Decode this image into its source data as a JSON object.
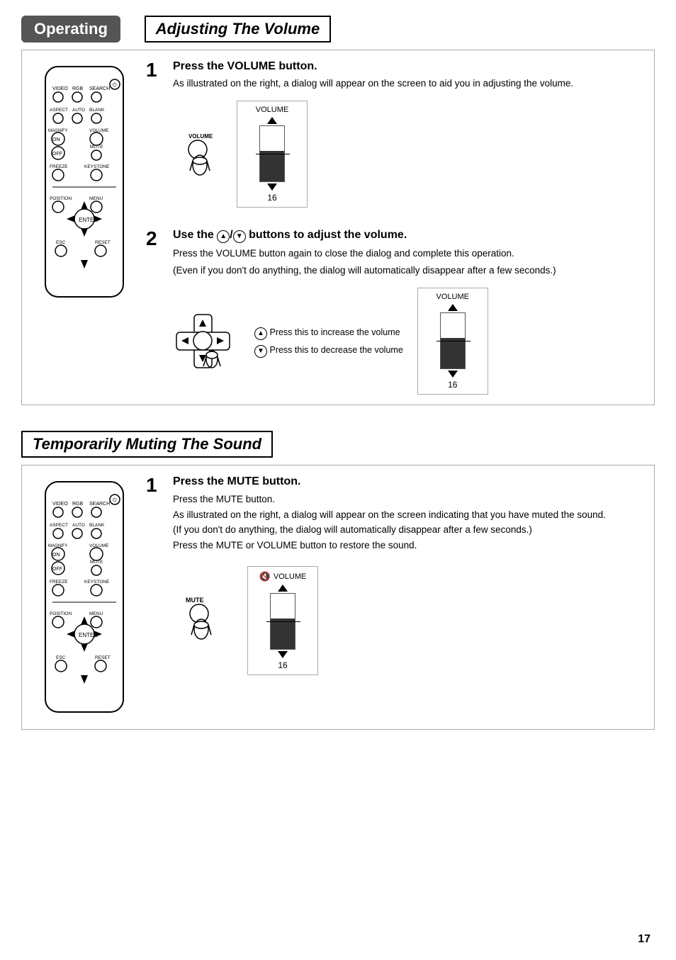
{
  "header": {
    "title": "Operating"
  },
  "section1": {
    "title": "Adjusting The Volume",
    "step1": {
      "number": "1",
      "title": "Press the VOLUME button.",
      "body": "As illustrated on the right, a dialog will appear on the screen to aid you in adjusting the volume.",
      "volume_label": "VOLUME",
      "volume_level": 16
    },
    "step2": {
      "number": "2",
      "title_part1": "Use the",
      "title_part2": "buttons to adjust the volume.",
      "body1": "Press the VOLUME button again to close the dialog and complete this operation.",
      "body2": "(Even if you don't do anything, the dialog will automatically disappear after a few seconds.)",
      "increase_label": "Press this to increase the volume",
      "decrease_label": "Press this to decrease the volume",
      "volume_label": "VOLUME",
      "volume_level": 16
    }
  },
  "section2": {
    "title": "Temporarily Muting The Sound",
    "step1": {
      "number": "1",
      "title": "Press the MUTE button.",
      "body1": "Press the MUTE button.",
      "body2": "As illustrated on the right, a dialog will appear on the screen indicating that you have muted the sound.",
      "body3": "(If you don't do anything, the dialog will automatically disappear after a few seconds.)",
      "body4": "Press the MUTE or VOLUME button to restore the sound.",
      "volume_label": "VOLUME",
      "volume_level": 16,
      "mute_label": "MUTE"
    }
  },
  "page_number": "17"
}
